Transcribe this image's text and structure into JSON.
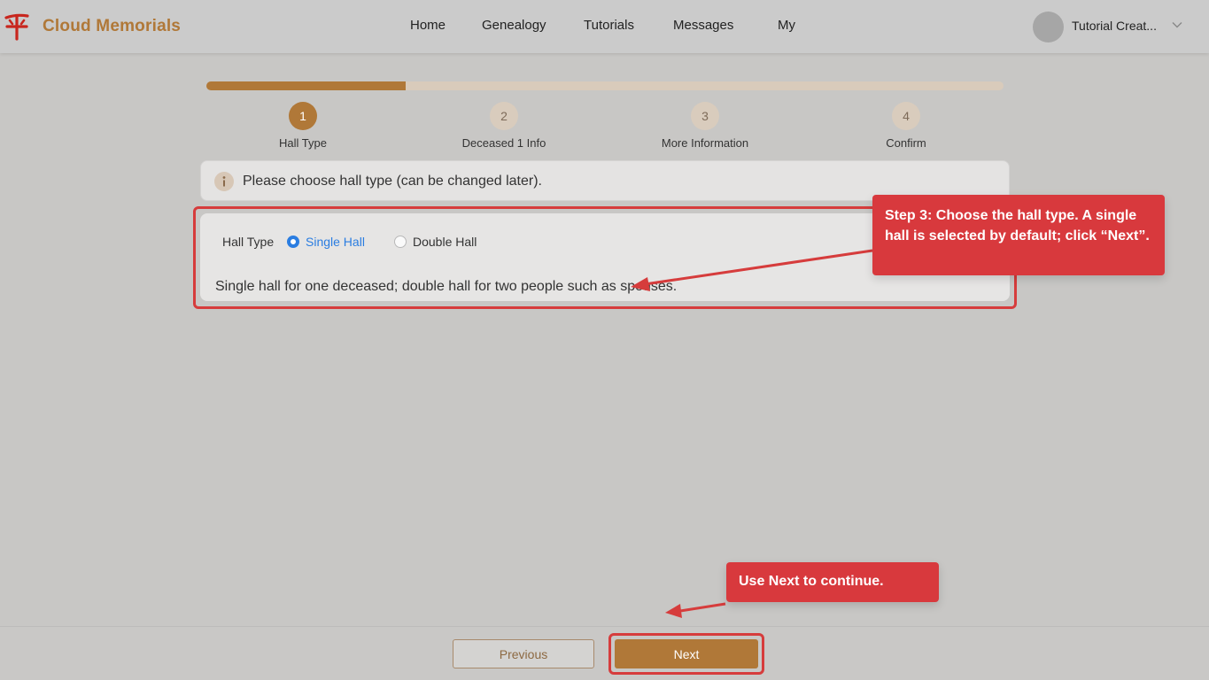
{
  "header": {
    "brand": "Cloud Memorials",
    "nav": [
      "Home",
      "Genealogy",
      "Tutorials",
      "Messages",
      "My"
    ],
    "user_name": "Tutorial Creat..."
  },
  "steps": {
    "progress": 0.25,
    "items": [
      {
        "number": "1",
        "label": "Hall Type",
        "active": true
      },
      {
        "number": "2",
        "label": "Deceased 1 Info",
        "active": false
      },
      {
        "number": "3",
        "label": "More Information",
        "active": false
      },
      {
        "number": "4",
        "label": "Confirm",
        "active": false
      }
    ]
  },
  "info": {
    "text": "Please choose hall type (can be changed later)."
  },
  "hall": {
    "label": "Hall Type",
    "options": [
      {
        "label": "Single Hall",
        "selected": true
      },
      {
        "label": "Double Hall",
        "selected": false
      }
    ],
    "description": "Single hall for one deceased; double hall for two people such as spouses."
  },
  "callouts": {
    "step3": "Step 3: Choose the hall type. A single hall is selected by default; click “Next”.",
    "next_hint": "Use Next to continue."
  },
  "footer": {
    "previous": "Previous",
    "next": "Next"
  },
  "colors": {
    "accent": "#b07838",
    "selected_blue": "#2a7de1",
    "annotation_red": "#d8393d"
  }
}
